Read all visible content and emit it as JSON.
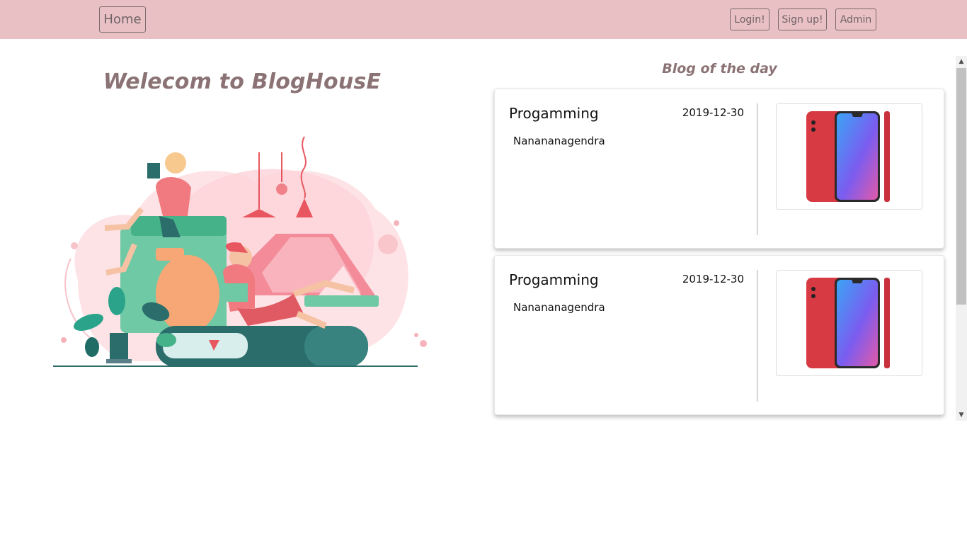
{
  "navbar": {
    "home_label": "Home",
    "login_label": "Login!",
    "signup_label": "Sign up!",
    "admin_label": "Admin"
  },
  "hero": {
    "title": "Welecom to BlogHousE",
    "illustration": "people-reading-books-illustration"
  },
  "blog": {
    "heading": "Blog of the day",
    "posts": [
      {
        "title": "Progamming",
        "date": "2019-12-30",
        "author": "Nanananagendra",
        "image": "red-smartphone-image"
      },
      {
        "title": "Progamming",
        "date": "2019-12-30",
        "author": "Nanananagendra",
        "image": "red-smartphone-image"
      }
    ]
  },
  "colors": {
    "navbar_bg": "#e9c1c4",
    "heading_text": "#8b7274",
    "phone_red": "#d83a44"
  }
}
